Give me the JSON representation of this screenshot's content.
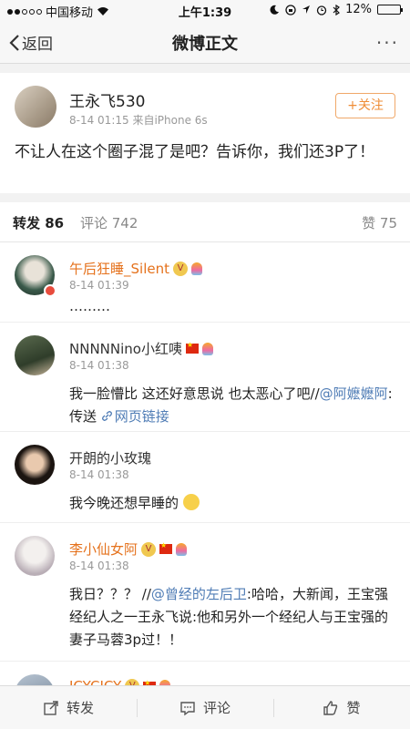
{
  "status_bar": {
    "carrier": "中国移动",
    "time": "上午1:39",
    "battery": "12%",
    "battery_level": 0.12
  },
  "nav": {
    "back_label": "返回",
    "title": "微博正文",
    "more": "···"
  },
  "post": {
    "username": "王永飞530",
    "meta": "8-14 01:15  来自iPhone 6s",
    "follow_label": "+关注",
    "text": "不让人在这个圈子混了是吧？告诉你，我们还3P了！"
  },
  "tabs": {
    "repost": "转发 86",
    "comment": "评论 742",
    "like": "赞 75"
  },
  "reposts": [
    {
      "username": "午后狂睡_Silent",
      "time": "8-14 01:39",
      "text": "………"
    },
    {
      "username": "NNNNNino小红咦",
      "time": "8-14 01:38",
      "text_prefix": "我一脸懵比 这还好意思说 也太恶心了吧//",
      "mention": "@阿嬷嬷阿",
      "text_suffix": ":传送 ",
      "link": "网页链接"
    },
    {
      "username": "开朗的小玫瑰",
      "time": "8-14 01:38",
      "text": "我今晚还想早睡的"
    },
    {
      "username": "李小仙女阿",
      "time": "8-14 01:38",
      "text_prefix": "我日？？？ //",
      "mention": "@曾经的左后卫",
      "text_suffix": ":哈哈，大新闻，王宝强经纪人之一王永飞说:他和另外一个经纪人与王宝强的妻子马蓉3p过！！"
    },
    {
      "username": "ICYCICY"
    }
  ],
  "bottom_bar": {
    "repost": "转发",
    "comment": "评论",
    "like": "赞"
  }
}
